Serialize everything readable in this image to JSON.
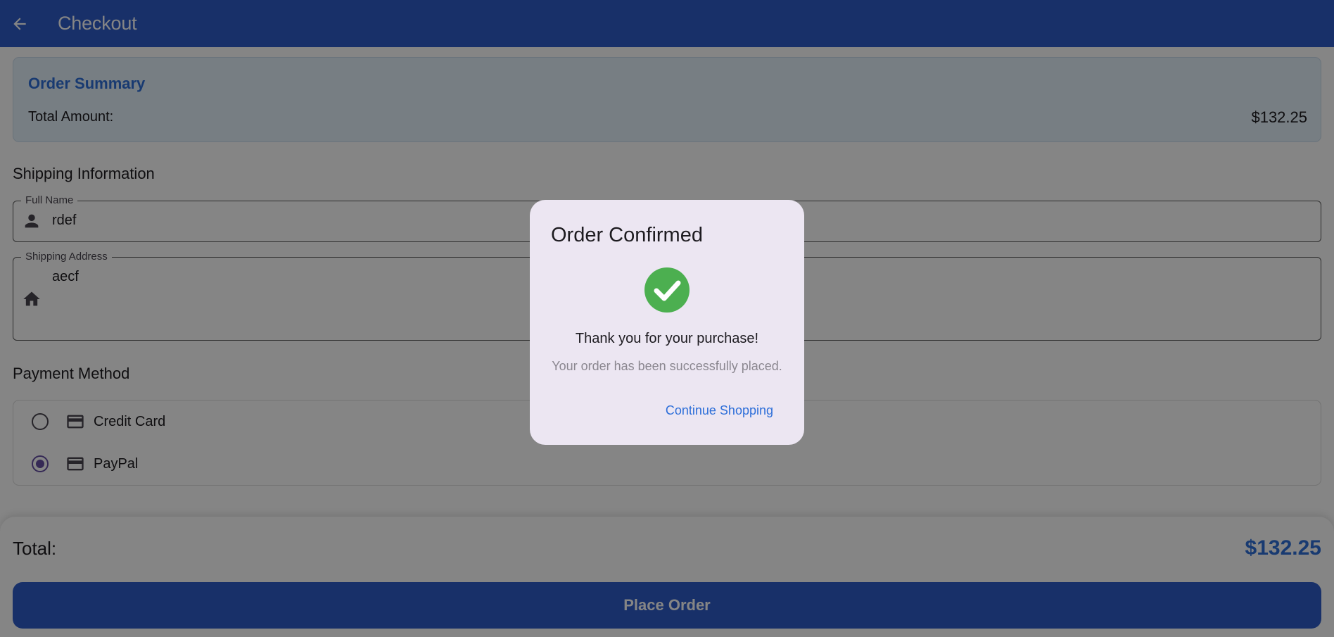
{
  "app_bar": {
    "title": "Checkout",
    "back_icon": "arrow-left-icon"
  },
  "order_summary": {
    "title": "Order Summary",
    "total_label": "Total Amount:",
    "total_value": "$132.25"
  },
  "shipping": {
    "section_title": "Shipping Information",
    "full_name": {
      "label": "Full Name",
      "value": "rdef",
      "icon": "person-icon"
    },
    "address": {
      "label": "Shipping Address",
      "value": "aecf",
      "icon": "home-icon"
    }
  },
  "payment": {
    "section_title": "Payment Method",
    "options": [
      {
        "label": "Credit Card",
        "selected": false,
        "icon": "credit-card-icon"
      },
      {
        "label": "PayPal",
        "selected": true,
        "icon": "credit-card-icon"
      }
    ]
  },
  "footer": {
    "total_label": "Total:",
    "total_value": "$132.25",
    "place_order_label": "Place Order"
  },
  "dialog": {
    "title": "Order Confirmed",
    "icon": "check-circle-icon",
    "message": "Thank you for your purchase!",
    "sub_message": "Your order has been successfully placed.",
    "action_label": "Continue Shopping"
  },
  "colors": {
    "primary": "#2e5cc9",
    "accent_text": "#2e6fd9",
    "success": "#4caf50",
    "radio_selected": "#6750a4",
    "dialog_bg": "#ece6f2"
  }
}
